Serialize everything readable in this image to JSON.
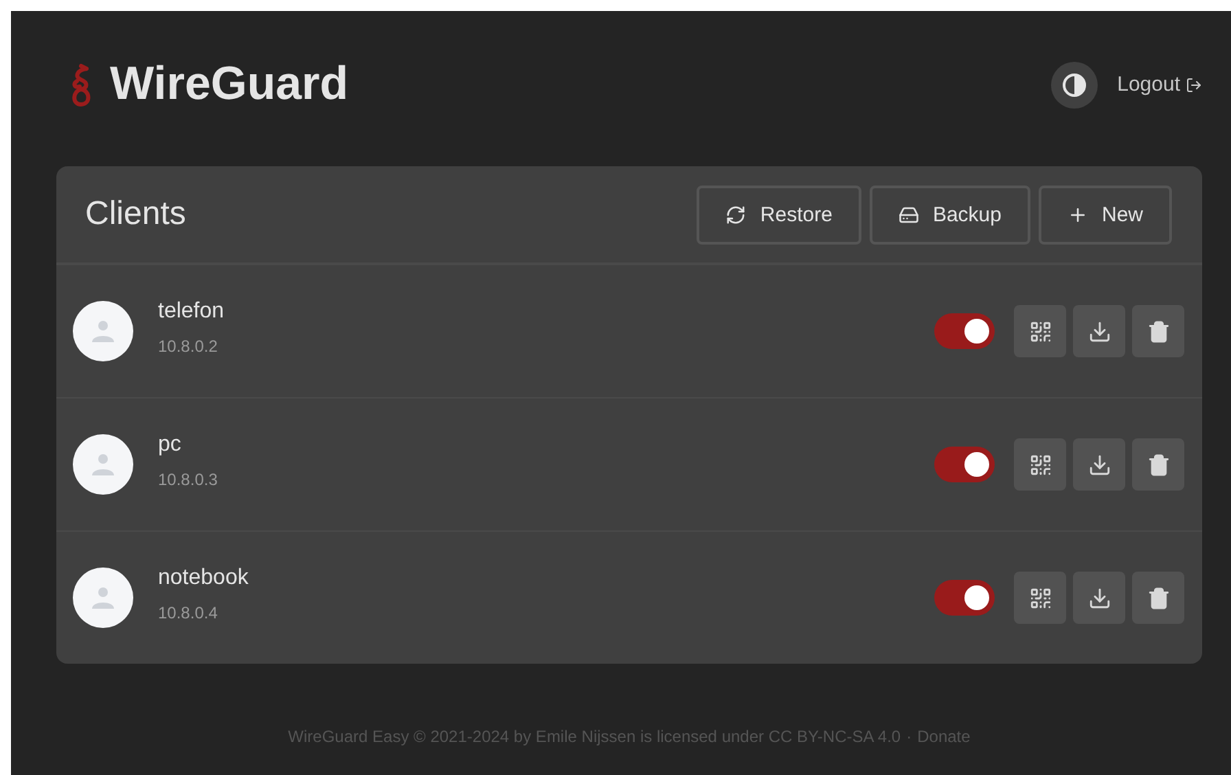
{
  "header": {
    "title": "WireGuard",
    "logout": "Logout"
  },
  "clients_card": {
    "title": "Clients",
    "actions": [
      {
        "kind": "restore",
        "label": "Restore"
      },
      {
        "kind": "backup",
        "label": "Backup"
      },
      {
        "kind": "new",
        "label": "New"
      }
    ],
    "clients": [
      {
        "name": "telefon",
        "address": "10.8.0.2",
        "enabled": true
      },
      {
        "name": "pc",
        "address": "10.8.0.3",
        "enabled": true
      },
      {
        "name": "notebook",
        "address": "10.8.0.4",
        "enabled": true
      }
    ]
  },
  "footer": {
    "text": "WireGuard Easy © 2021-2024 by Emile Nijssen is licensed under CC BY-NC-SA 4.0",
    "separator": "·",
    "link": "Donate"
  }
}
